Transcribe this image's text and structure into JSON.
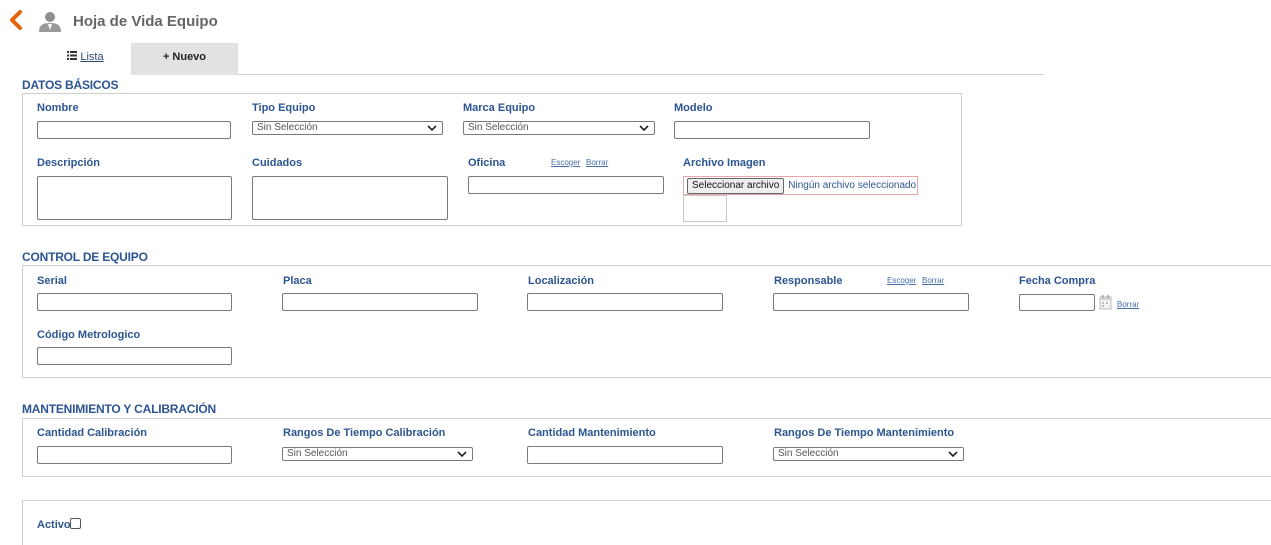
{
  "header": {
    "title": "Hoja de Vida Equipo",
    "back_icon": "chevron-left-icon",
    "person_icon": "user-icon",
    "accent": "#e8640c"
  },
  "tabs": [
    {
      "label": "Lista",
      "icon": "list-icon"
    },
    {
      "label": "Nuevo",
      "icon": "plus-icon"
    }
  ],
  "datos_basicos": {
    "title": "DATOS BÁSICOS",
    "nombre": "Nombre",
    "tipo_equipo": "Tipo Equipo",
    "tipo_equipo_value": "Sin Selección",
    "marca_equipo": "Marca Equipo",
    "marca_equipo_value": "Sin Selección",
    "modelo": "Modelo",
    "descripcion": "Descripción",
    "cuidados": "Cuidados",
    "oficina": "Oficina",
    "escoger": "Escoger",
    "borrar": "Borrar",
    "archivo_imagen": "Archivo Imagen",
    "file_button": "Seleccionar archivo",
    "file_status": "Ningún archivo seleccionado"
  },
  "control_equipo": {
    "title": "CONTROL DE EQUIPO",
    "serial": "Serial",
    "placa": "Placa",
    "localizacion": "Localización",
    "responsable": "Responsable",
    "escoger": "Escoger",
    "borrar": "Borrar",
    "fecha_compra": "Fecha Compra",
    "fecha_borrar": "Borrar",
    "codigo_metrologico": "Código Metrologico"
  },
  "mantenimiento": {
    "title": "MANTENIMIENTO Y CALIBRACIÓN",
    "cantidad_calibracion": "Cantidad Calibración",
    "rangos_calibracion": "Rangos De Tiempo Calibración",
    "rangos_calibracion_value": "Sin Selección",
    "cantidad_mantenimiento": "Cantidad Mantenimiento",
    "rangos_mantenimiento": "Rangos De Tiempo Mantenimiento",
    "rangos_mantenimiento_value": "Sin Selección"
  },
  "estado": {
    "activo": "Activo"
  }
}
